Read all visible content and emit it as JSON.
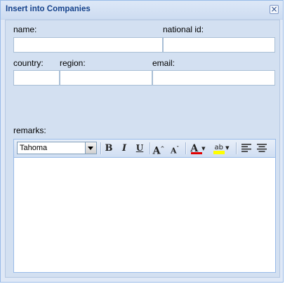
{
  "window": {
    "title": "Insert into Companies"
  },
  "form": {
    "name_label": "name:",
    "name_value": "",
    "national_id_label": "national id:",
    "national_id_value": "",
    "country_label": "country:",
    "country_value": "",
    "region_label": "region:",
    "region_value": "",
    "email_label": "email:",
    "email_value": "",
    "remarks_label": "remarks:"
  },
  "editor": {
    "font_family": "Tahoma",
    "buttons": {
      "bold": "B",
      "italic": "I",
      "underline": "U",
      "grow": "A",
      "shrink": "A",
      "font_color": "A",
      "highlight": "ab"
    },
    "font_color_value": "#e00000",
    "highlight_color_value": "#ffff00",
    "content": ""
  }
}
